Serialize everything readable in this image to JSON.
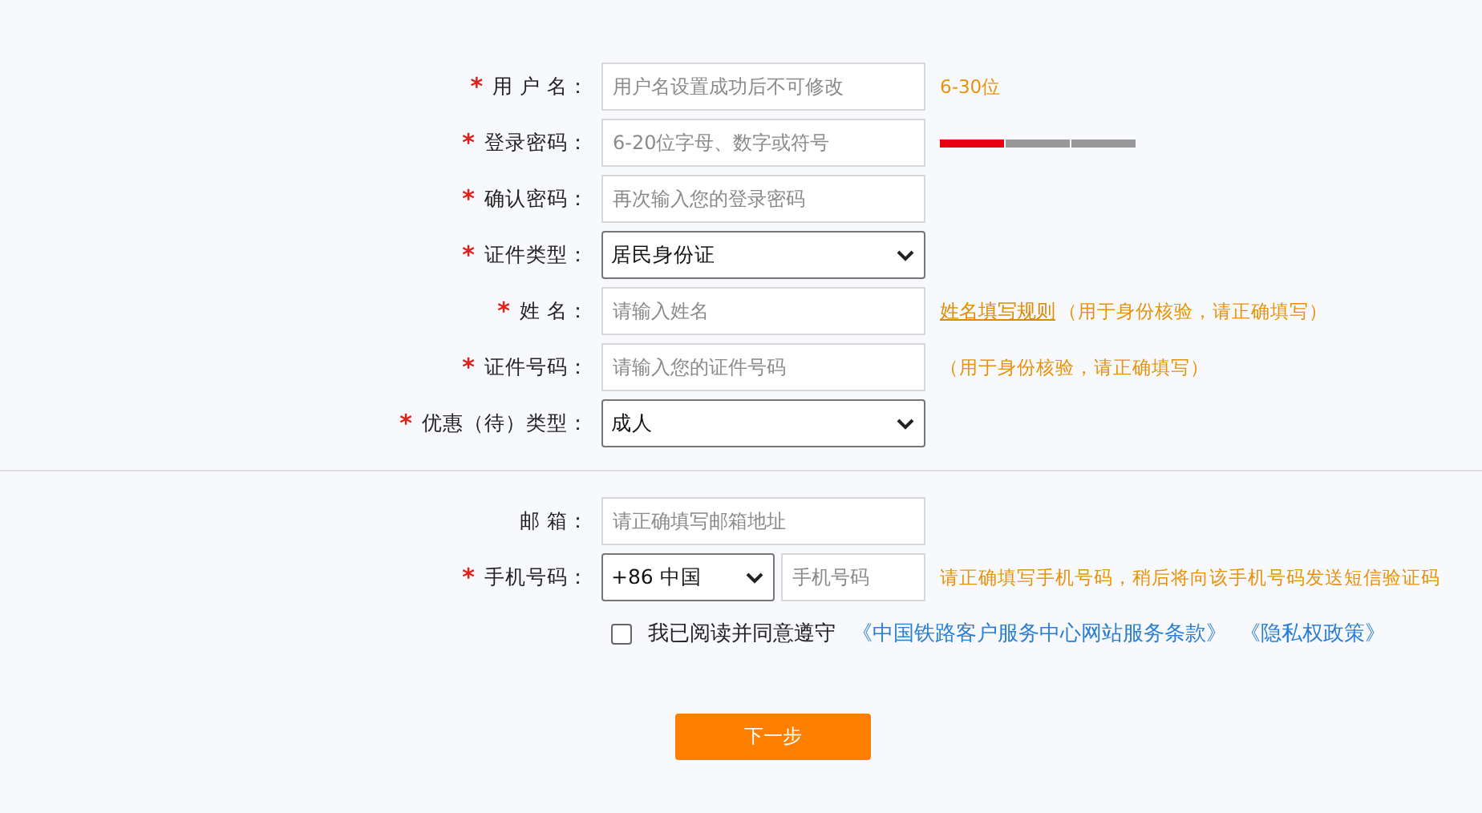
{
  "sections": [
    {
      "rows": [
        {
          "kind": "input",
          "asterisk": "*",
          "label": "用 户 名：",
          "placeholder": "用户名设置成功后不可修改",
          "hint": "6-30位"
        },
        {
          "kind": "input",
          "asterisk": "*",
          "label": "登录密码：",
          "placeholder": "6-20位字母、数字或符号",
          "strength": {
            "level": 0.33
          }
        },
        {
          "kind": "input",
          "asterisk": "*",
          "label": "确认密码：",
          "placeholder": "再次输入您的登录密码"
        },
        {
          "kind": "select",
          "asterisk": "*",
          "label": "证件类型：",
          "value": "居民身份证"
        },
        {
          "kind": "input",
          "asterisk": "*",
          "label": "姓 名：",
          "placeholder": "请输入姓名",
          "link": "姓名填写规则",
          "hint": "（用于身份核验，请正确填写）"
        },
        {
          "kind": "input",
          "asterisk": "*",
          "label": "证件号码：",
          "placeholder": "请输入您的证件号码",
          "hint": "（用于身份核验，请正确填写）"
        },
        {
          "kind": "select",
          "asterisk": "*",
          "label": "优惠（待）类型：",
          "value": "成人"
        }
      ]
    },
    {
      "rows": [
        {
          "kind": "input",
          "label": "邮 箱：",
          "placeholder": "请正确填写邮箱地址"
        },
        {
          "kind": "phone",
          "asterisk": "*",
          "label": "手机号码：",
          "value": "+86 中国",
          "placeholder": "手机号码",
          "hint": "请正确填写手机号码，稍后将向该手机号码发送短信验证码"
        }
      ]
    }
  ],
  "agreement": {
    "checked": false,
    "text": "我已阅读并同意遵守",
    "links": [
      "《中国铁路客户服务中心网站服务条款》",
      "《隐私权政策》"
    ]
  },
  "next_button": "下一步"
}
